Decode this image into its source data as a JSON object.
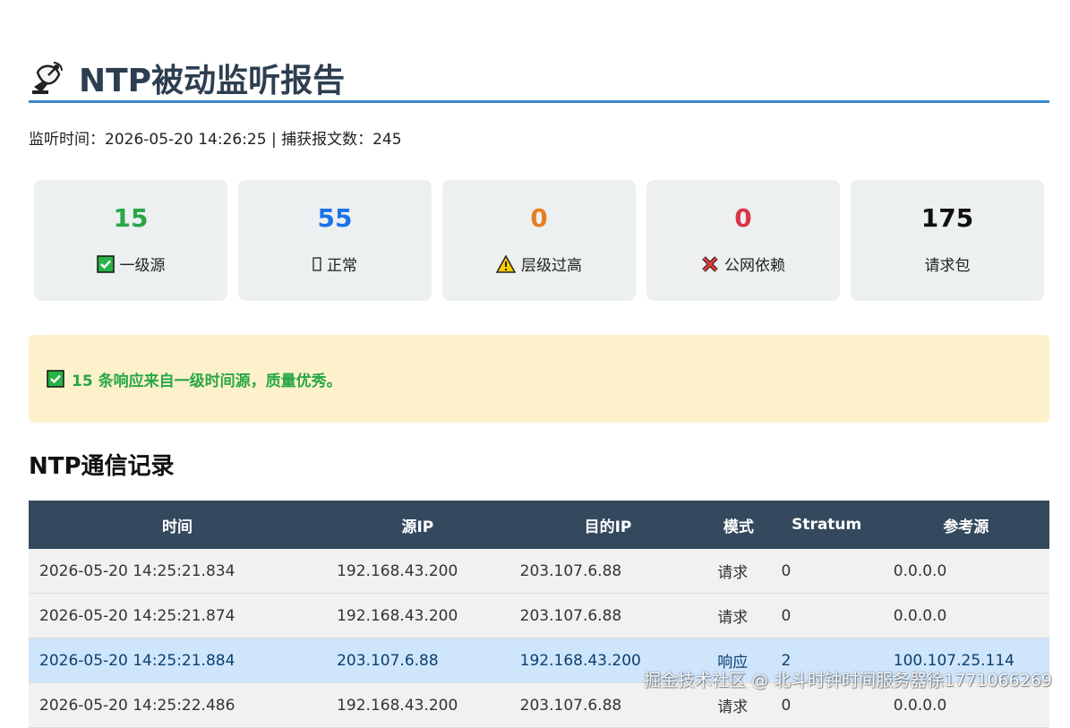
{
  "header": {
    "title": "NTP被动监听报告",
    "meta_time_label": "监听时间：",
    "meta_time": "2026-05-20 14:26:25",
    "meta_sep": " | ",
    "meta_count_label": "捕获报文数：",
    "meta_count": "245"
  },
  "stats": [
    {
      "value": "15",
      "label": "一级源",
      "color": "#28a745",
      "icon": "check-box-icon"
    },
    {
      "value": "55",
      "label": "正常",
      "color": "#1a73e8",
      "icon": "missing-glyph-icon"
    },
    {
      "value": "0",
      "label": "层级过高",
      "color": "#e67e22",
      "icon": "warning-icon"
    },
    {
      "value": "0",
      "label": "公网依赖",
      "color": "#dc3545",
      "icon": "cross-icon"
    },
    {
      "value": "175",
      "label": "请求包",
      "color": "#111111",
      "icon": ""
    }
  ],
  "alert": {
    "text": "15 条响应来自一级时间源，质量优秀。",
    "icon": "check-box-icon"
  },
  "section": {
    "title": "NTP通信记录"
  },
  "table": {
    "headers": [
      "时间",
      "源IP",
      "目的IP",
      "模式",
      "Stratum",
      "参考源"
    ],
    "rows": [
      {
        "time": "2026-05-20 14:25:21.834",
        "src": "192.168.43.200",
        "dst": "203.107.6.88",
        "mode": "请求",
        "stratum": "0",
        "ref": "0.0.0.0",
        "kind": "req"
      },
      {
        "time": "2026-05-20 14:25:21.874",
        "src": "192.168.43.200",
        "dst": "203.107.6.88",
        "mode": "请求",
        "stratum": "0",
        "ref": "0.0.0.0",
        "kind": "req"
      },
      {
        "time": "2026-05-20 14:25:21.884",
        "src": "203.107.6.88",
        "dst": "192.168.43.200",
        "mode": "响应",
        "stratum": "2",
        "ref": "100.107.25.114",
        "kind": "resp"
      },
      {
        "time": "2026-05-20 14:25:22.486",
        "src": "192.168.43.200",
        "dst": "203.107.6.88",
        "mode": "请求",
        "stratum": "0",
        "ref": "0.0.0.0",
        "kind": "req"
      }
    ]
  },
  "watermark": "掘金技术社区 @ 北斗时钟时间服务器徐1771066269"
}
